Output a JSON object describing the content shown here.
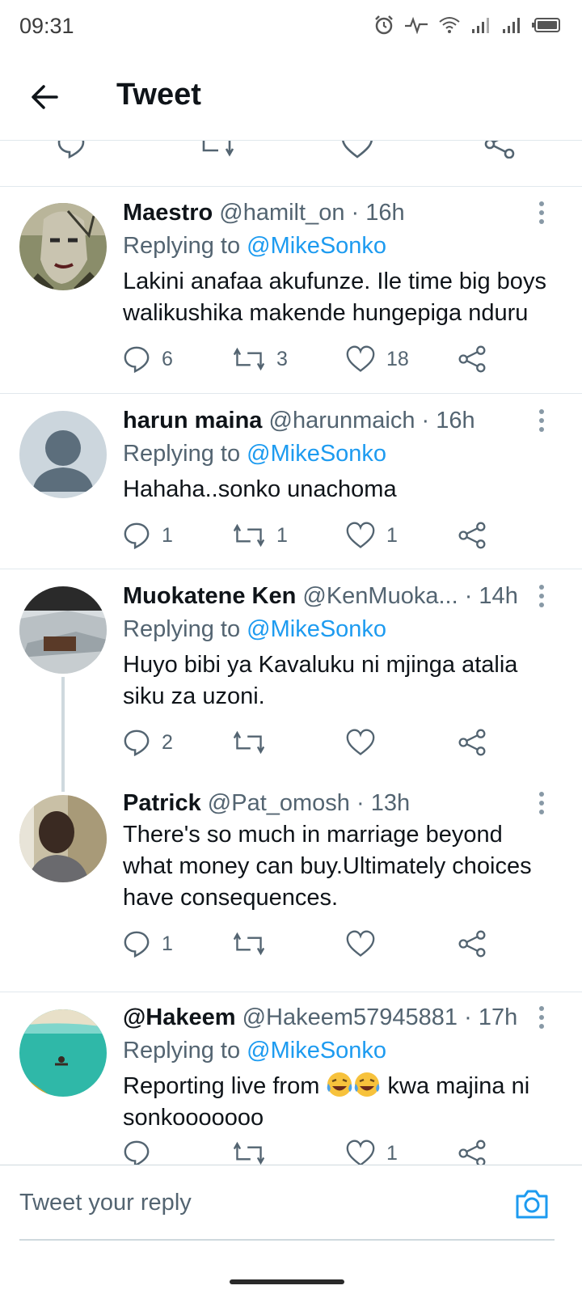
{
  "status": {
    "time": "09:31",
    "icons": [
      "alarm-icon",
      "activity-icon",
      "wifi-icon",
      "signal-icon",
      "signal-icon",
      "battery-icon"
    ]
  },
  "header": {
    "title": "Tweet",
    "back_icon": "arrow-left-icon"
  },
  "colors": {
    "accent": "#1d9bf0",
    "text": "#0f1419",
    "muted": "#536471",
    "divider": "#e1e8ed"
  },
  "tweets": [
    {
      "name": "Maestro",
      "handle": "@hamilt_on",
      "time": "· 16h",
      "replying_prefix": "Replying to",
      "replying_to": "@MikeSonko",
      "text_line1": "Lakini anafaa akufunze. Ile time big boys",
      "text_line2": "walikushika makende hungepiga nduru",
      "replies": "6",
      "retweets": "3",
      "likes": "18"
    },
    {
      "name": "harun maina",
      "handle": "@harunmaich",
      "time": "· 16h",
      "replying_prefix": "Replying to",
      "replying_to": "@MikeSonko",
      "text_line1": "Hahaha..sonko unachoma",
      "replies": "1",
      "retweets": "1",
      "likes": "1"
    },
    {
      "name": "Muokatene Ken",
      "handle": "@KenMuoka...",
      "time": "· 14h",
      "replying_prefix": "Replying to",
      "replying_to": "@MikeSonko",
      "text_line1": "Huyo bibi ya Kavaluku ni mjinga atalia",
      "text_line2": "siku za uzoni.",
      "replies": "2",
      "retweets": "",
      "likes": ""
    },
    {
      "name": "Patrick",
      "handle": "@Pat_omosh",
      "time": "· 13h",
      "text_line1": "There's so much in marriage beyond",
      "text_line2": "what money can buy.Ultimately choices",
      "text_line3": "have consequences.",
      "replies": "1",
      "retweets": "",
      "likes": ""
    },
    {
      "name": "@Hakeem",
      "handle": "@Hakeem57945881",
      "time": "· 17h",
      "replying_prefix": "Replying to",
      "replying_to": "@MikeSonko",
      "text_line1_a": "Reporting live from",
      "text_line1_b": "kwa majina ni",
      "text_line2": "sonkooooooo",
      "replies": "",
      "retweets": "",
      "likes": "1"
    }
  ],
  "composer": {
    "placeholder": "Tweet your reply",
    "camera_icon": "camera-icon"
  }
}
